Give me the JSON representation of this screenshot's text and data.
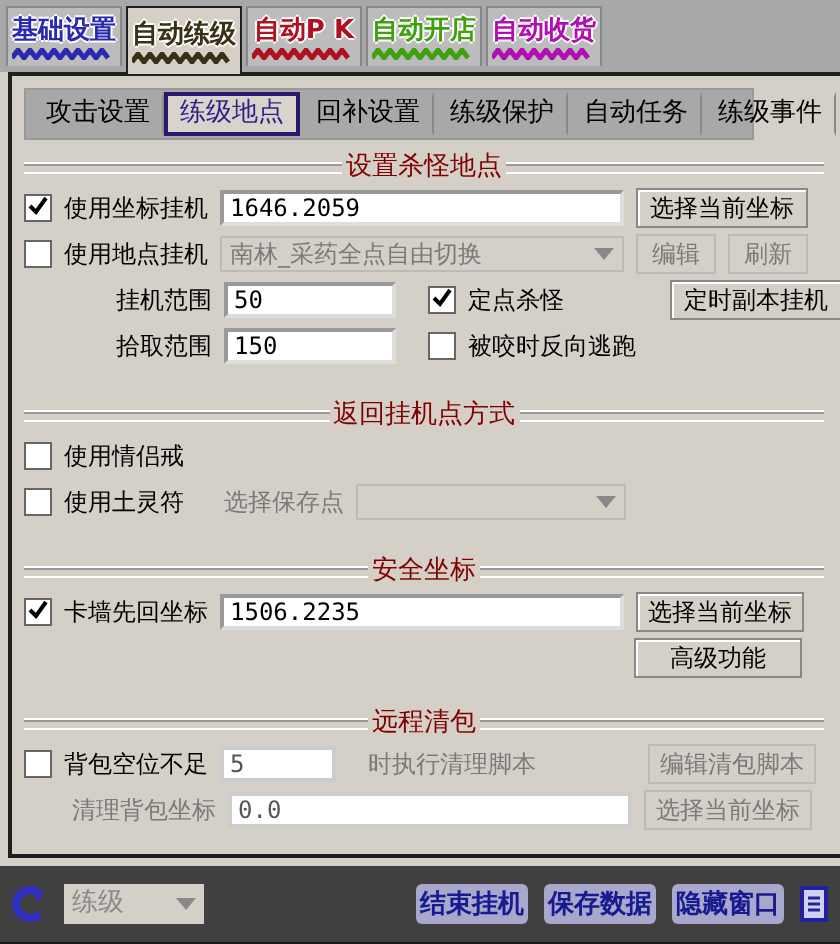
{
  "main_tabs": [
    {
      "label": "基础设置",
      "color": "#2a2ab0",
      "selected": false
    },
    {
      "label": "自动练级",
      "color": "#3a3018",
      "selected": true
    },
    {
      "label": "自动P K",
      "color": "#b01020",
      "selected": false
    },
    {
      "label": "自动开店",
      "color": "#40a010",
      "selected": false
    },
    {
      "label": "自动收货",
      "color": "#b010b0",
      "selected": false
    }
  ],
  "sub_tabs": [
    {
      "label": "攻击设置",
      "selected": false
    },
    {
      "label": "练级地点",
      "selected": true
    },
    {
      "label": "回补设置",
      "selected": false
    },
    {
      "label": "练级保护",
      "selected": false
    },
    {
      "label": "自动任务",
      "selected": false
    },
    {
      "label": "练级事件",
      "selected": false
    }
  ],
  "kill_location": {
    "title": "设置杀怪地点",
    "coord": {
      "label": "使用坐标挂机",
      "checked": true,
      "value": "1646.2059",
      "button": "选择当前坐标"
    },
    "place": {
      "label": "使用地点挂机",
      "checked": false,
      "value": "南林_采药全点自由切换",
      "disabled": true,
      "buttons": [
        {
          "label": "编辑",
          "disabled": true
        },
        {
          "label": "刷新",
          "disabled": true
        }
      ]
    },
    "range": {
      "label": "挂机范围",
      "value": "50"
    },
    "pickup": {
      "label": "拾取范围",
      "value": "150"
    },
    "fixed_kill": {
      "label": "定点杀怪",
      "checked": true
    },
    "flee": {
      "label": "被咬时反向逃跑",
      "checked": false
    },
    "timer_button": "定时副本挂机"
  },
  "return_method": {
    "title": "返回挂机点方式",
    "ring": {
      "label": "使用情侣戒",
      "checked": false
    },
    "talisman": {
      "label": "使用土灵符",
      "checked": false
    },
    "save_point": {
      "label": "选择保存点",
      "disabled": true
    }
  },
  "safe_coord": {
    "title": "安全坐标",
    "stuck": {
      "label": "卡墙先回坐标",
      "checked": true,
      "value": "1506.2235"
    },
    "button": "选择当前坐标",
    "advanced_button": "高级功能"
  },
  "remote_clean": {
    "title": "远程清包",
    "bag": {
      "label": "背包空位不足",
      "checked": false,
      "value": "5",
      "suffix": "时执行清理脚本",
      "disabled": true
    },
    "edit_button": "编辑清包脚本",
    "clean_coord": {
      "label": "清理背包坐标",
      "value": "0.0",
      "disabled": true
    },
    "select_button": "选择当前坐标"
  },
  "bottom_bar": {
    "mode": "练级",
    "buttons": [
      "结束挂机",
      "保存数据",
      "隐藏窗口"
    ]
  }
}
